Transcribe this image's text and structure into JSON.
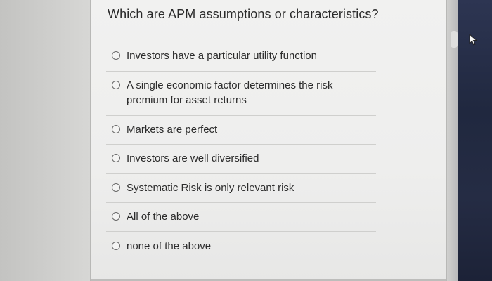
{
  "question": {
    "title": "Which are APM assumptions or characteristics?",
    "options": [
      {
        "label": "Investors have a particular utility function",
        "selected": false
      },
      {
        "label": "A single economic factor determines the risk premium for asset returns",
        "selected": false
      },
      {
        "label": "Markets are perfect",
        "selected": false
      },
      {
        "label": "Investors are well diversified",
        "selected": false
      },
      {
        "label": "Systematic Risk is only relevant risk",
        "selected": false
      },
      {
        "label": "All of the above",
        "selected": false
      },
      {
        "label": "none of the above",
        "selected": false
      }
    ]
  },
  "icons": {
    "radio": "radio-unchecked-icon",
    "cursor": "mouse-pointer-icon"
  },
  "colors": {
    "card": "#f0f0ef",
    "text": "#2c2c2c",
    "radio_border": "#6a6a6a",
    "right_background": "#232a42"
  }
}
